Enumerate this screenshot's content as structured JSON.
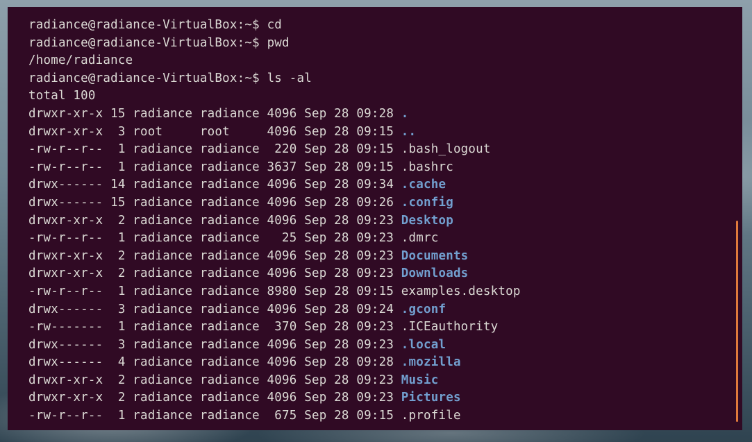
{
  "terminal": {
    "colors": {
      "background": "#300a24",
      "text": "#dcdad5",
      "directory": "#729fcf",
      "scrollbar": "#e07a3c"
    },
    "lines": [
      {
        "type": "cmd",
        "prompt": "radiance@radiance-VirtualBox:~$ ",
        "command": "cd"
      },
      {
        "type": "cmd",
        "prompt": "radiance@radiance-VirtualBox:~$ ",
        "command": "pwd"
      },
      {
        "type": "out",
        "text": "/home/radiance"
      },
      {
        "type": "cmd",
        "prompt": "radiance@radiance-VirtualBox:~$ ",
        "command": "ls -al"
      },
      {
        "type": "out",
        "text": "total 100"
      },
      {
        "type": "ls",
        "meta": "drwxr-xr-x 15 radiance radiance 4096 Sep 28 09:28 ",
        "name": ".",
        "dir": true
      },
      {
        "type": "ls",
        "meta": "drwxr-xr-x  3 root     root     4096 Sep 28 09:15 ",
        "name": "..",
        "dir": true
      },
      {
        "type": "ls",
        "meta": "-rw-r--r--  1 radiance radiance  220 Sep 28 09:15 ",
        "name": ".bash_logout",
        "dir": false
      },
      {
        "type": "ls",
        "meta": "-rw-r--r--  1 radiance radiance 3637 Sep 28 09:15 ",
        "name": ".bashrc",
        "dir": false
      },
      {
        "type": "ls",
        "meta": "drwx------ 14 radiance radiance 4096 Sep 28 09:34 ",
        "name": ".cache",
        "dir": true
      },
      {
        "type": "ls",
        "meta": "drwx------ 15 radiance radiance 4096 Sep 28 09:26 ",
        "name": ".config",
        "dir": true
      },
      {
        "type": "ls",
        "meta": "drwxr-xr-x  2 radiance radiance 4096 Sep 28 09:23 ",
        "name": "Desktop",
        "dir": true
      },
      {
        "type": "ls",
        "meta": "-rw-r--r--  1 radiance radiance   25 Sep 28 09:23 ",
        "name": ".dmrc",
        "dir": false
      },
      {
        "type": "ls",
        "meta": "drwxr-xr-x  2 radiance radiance 4096 Sep 28 09:23 ",
        "name": "Documents",
        "dir": true
      },
      {
        "type": "ls",
        "meta": "drwxr-xr-x  2 radiance radiance 4096 Sep 28 09:23 ",
        "name": "Downloads",
        "dir": true
      },
      {
        "type": "ls",
        "meta": "-rw-r--r--  1 radiance radiance 8980 Sep 28 09:15 ",
        "name": "examples.desktop",
        "dir": false
      },
      {
        "type": "ls",
        "meta": "drwx------  3 radiance radiance 4096 Sep 28 09:24 ",
        "name": ".gconf",
        "dir": true
      },
      {
        "type": "ls",
        "meta": "-rw-------  1 radiance radiance  370 Sep 28 09:23 ",
        "name": ".ICEauthority",
        "dir": false
      },
      {
        "type": "ls",
        "meta": "drwx------  3 radiance radiance 4096 Sep 28 09:23 ",
        "name": ".local",
        "dir": true
      },
      {
        "type": "ls",
        "meta": "drwx------  4 radiance radiance 4096 Sep 28 09:28 ",
        "name": ".mozilla",
        "dir": true
      },
      {
        "type": "ls",
        "meta": "drwxr-xr-x  2 radiance radiance 4096 Sep 28 09:23 ",
        "name": "Music",
        "dir": true
      },
      {
        "type": "ls",
        "meta": "drwxr-xr-x  2 radiance radiance 4096 Sep 28 09:23 ",
        "name": "Pictures",
        "dir": true
      },
      {
        "type": "ls",
        "meta": "-rw-r--r--  1 radiance radiance  675 Sep 28 09:15 ",
        "name": ".profile",
        "dir": false
      }
    ]
  }
}
